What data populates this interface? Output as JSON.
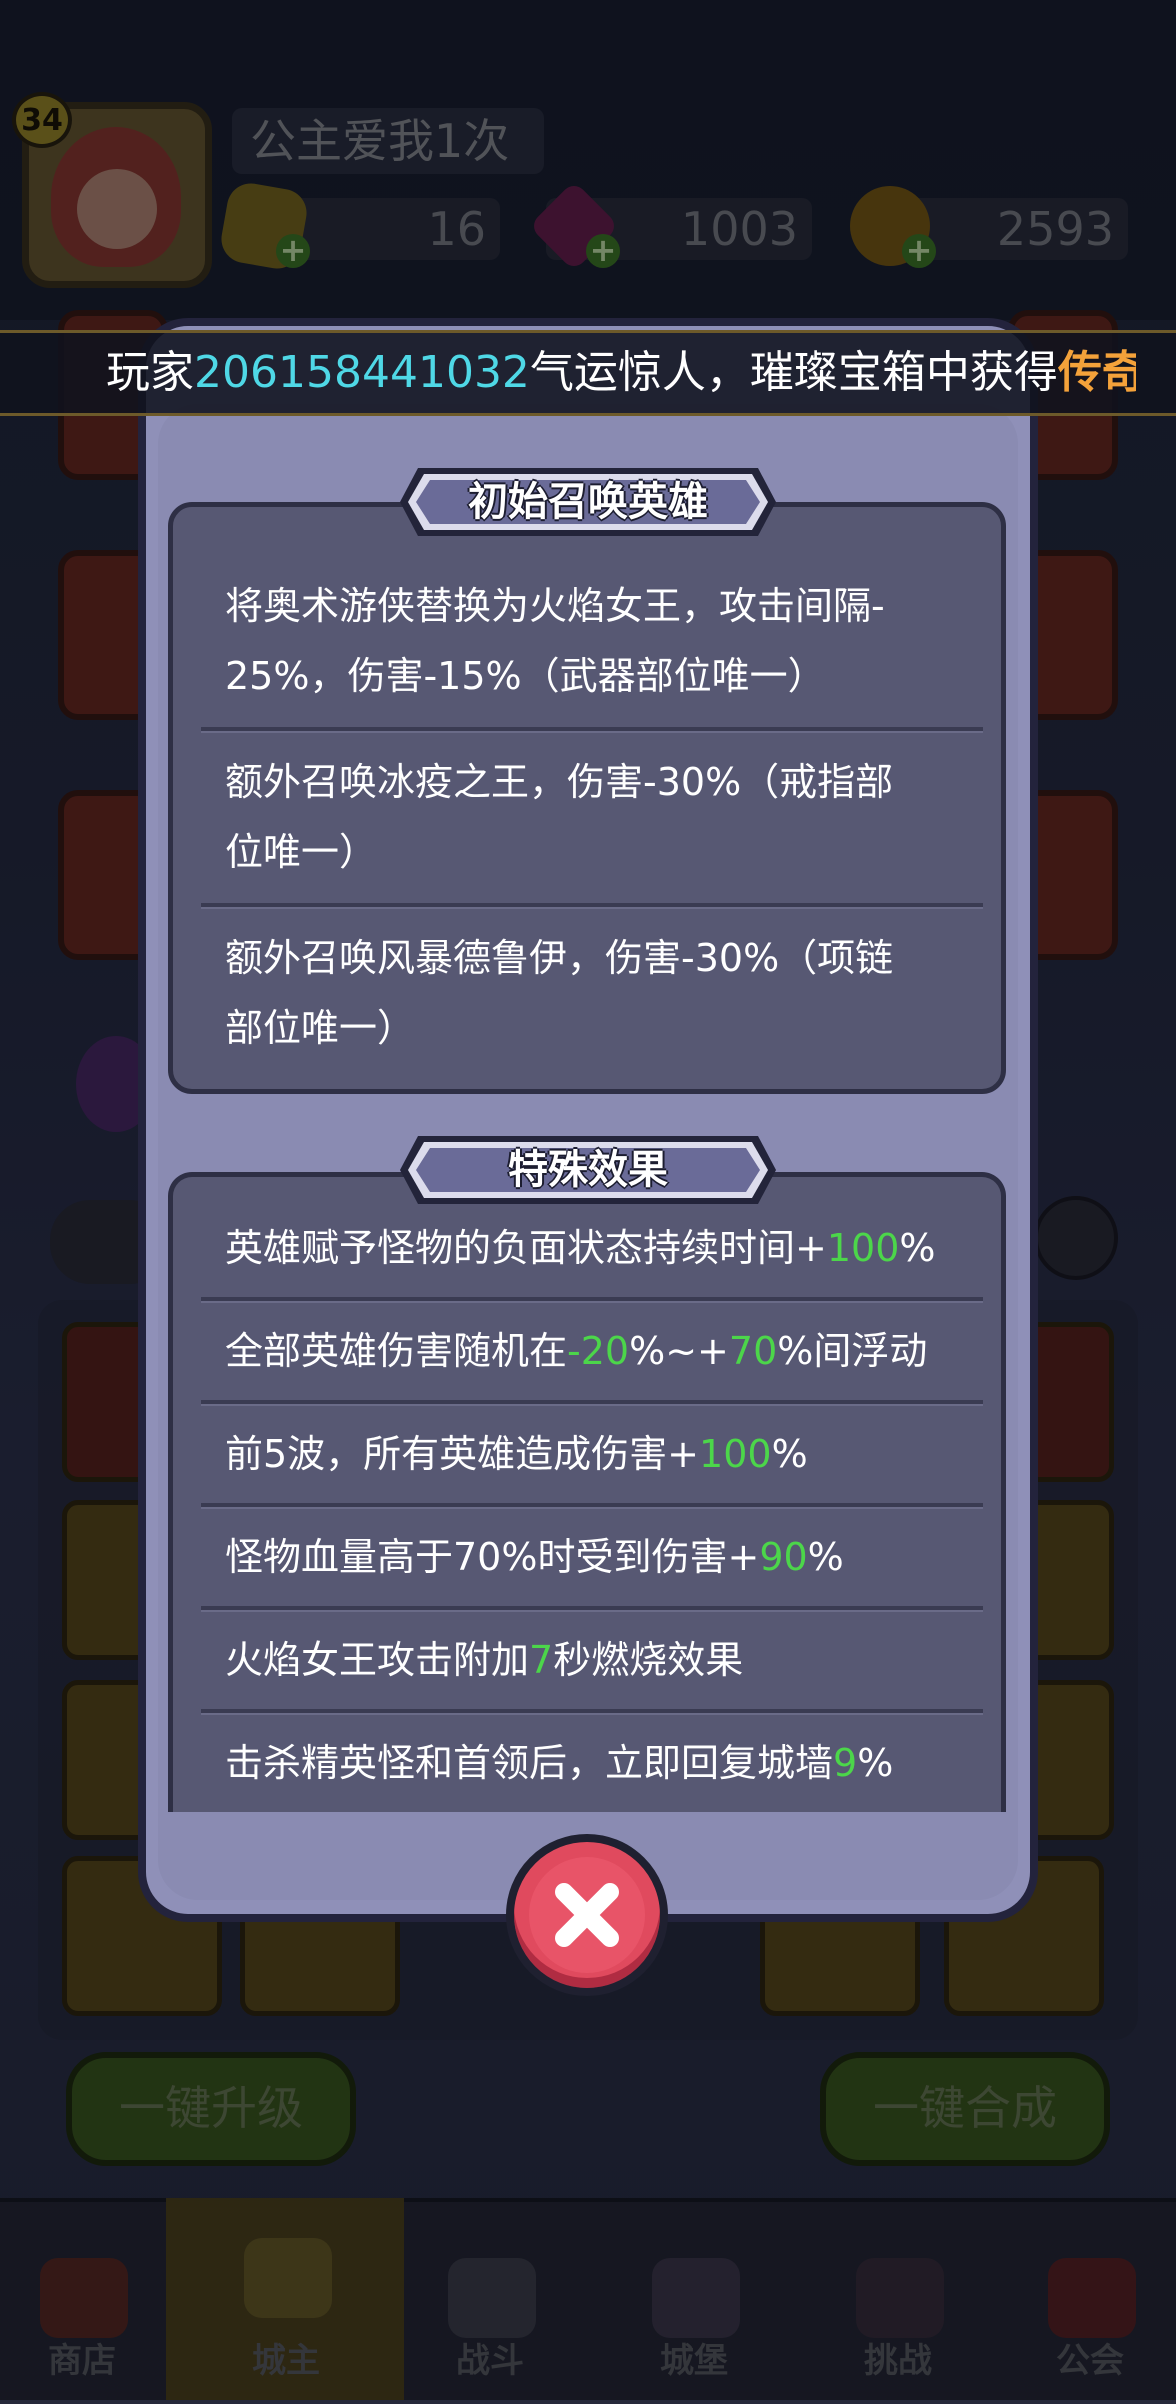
{
  "header": {
    "level": "34",
    "player_name": "公主爱我1次",
    "resources": {
      "gold_bars": "16",
      "gems": "1003",
      "coins": "2593"
    }
  },
  "ticker": {
    "prefix": "玩家",
    "player_id": "206158441032",
    "middle": "气运惊人，璀璨宝箱中获得",
    "rarity": "传奇"
  },
  "buttons": {
    "upgrade_all": "一键升级",
    "merge_all": "一键合成"
  },
  "nav": {
    "items": [
      {
        "label": "商店",
        "icon": "shop-icon"
      },
      {
        "label": "城主",
        "icon": "crown-icon"
      },
      {
        "label": "战斗",
        "icon": "swords-icon"
      },
      {
        "label": "城堡",
        "icon": "castle-icon"
      },
      {
        "label": "挑战",
        "icon": "demon-icon"
      },
      {
        "label": "公会",
        "icon": "guild-banner-icon"
      }
    ]
  },
  "modal": {
    "section1": {
      "title": "初始召唤英雄",
      "items": [
        {
          "line1": "将奥术游侠替换为火焰女王，攻击间隔-",
          "line2": "25%，伤害-15%（武器部位唯一）"
        },
        {
          "line1": "额外召唤冰疫之王，伤害-30%（戒指部",
          "line2": "位唯一）"
        },
        {
          "line1": "额外召唤风暴德鲁伊，伤害-30%（项链",
          "line2": "部位唯一）"
        }
      ]
    },
    "section2": {
      "title": "特殊效果",
      "effects": [
        {
          "pre": "英雄赋予怪物的负面状态持续时间+",
          "v1": "100",
          "mid": "%",
          "v2": "",
          "post": ""
        },
        {
          "pre": "全部英雄伤害随机在",
          "v1": "-20",
          "mid": "%~+",
          "v2": "70",
          "post": "%间浮动"
        },
        {
          "pre": "前5波，所有英雄造成伤害+",
          "v1": "100",
          "mid": "%",
          "v2": "",
          "post": ""
        },
        {
          "pre": "怪物血量高于70%时受到伤害+",
          "v1": "90",
          "mid": "%",
          "v2": "",
          "post": ""
        },
        {
          "pre": "火焰女王攻击附加",
          "v1": "7",
          "mid": "秒燃烧效果",
          "v2": "",
          "post": ""
        },
        {
          "pre": "击杀精英怪和首领后，立即回复城墙",
          "v1": "9",
          "mid": "%",
          "v2": "",
          "post": ""
        }
      ]
    },
    "close_icon": "close-icon"
  },
  "colors": {
    "highlight_cyan": "#4fd8e6",
    "legendary_orange": "#f4a23a",
    "value_green": "#4cd64a",
    "close_red": "#e04a5e"
  }
}
